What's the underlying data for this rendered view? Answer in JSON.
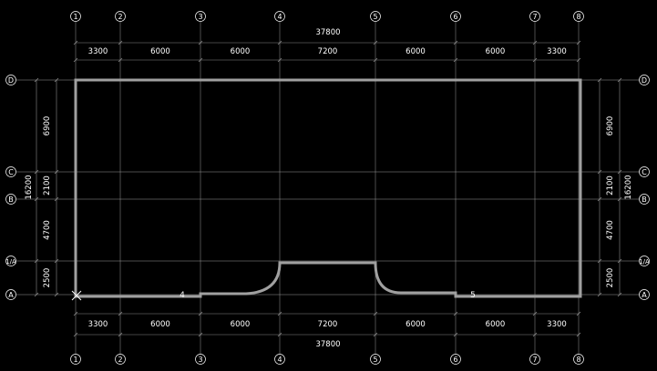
{
  "colors": {
    "background": "#000000",
    "grid": "#9a9a9a",
    "dim": "#8a8a8a",
    "outline": "#a0a0a0",
    "text": "#ffffff",
    "marker": "#ffffff"
  },
  "axes_x": {
    "labels": [
      "1",
      "2",
      "3",
      "4",
      "5",
      "6",
      "7",
      "8"
    ],
    "spacings": [
      "3300",
      "6000",
      "6000",
      "7200",
      "6000",
      "6000",
      "3300"
    ],
    "total": "37800"
  },
  "axes_y": {
    "labels": [
      "A",
      "1/A",
      "B",
      "C",
      "D"
    ],
    "spacings": [
      "2500",
      "4700",
      "2100",
      "6900"
    ],
    "total": "16200"
  },
  "markers": {
    "point_4": "4",
    "point_5": "5",
    "start_icon": "x-mark-icon"
  }
}
